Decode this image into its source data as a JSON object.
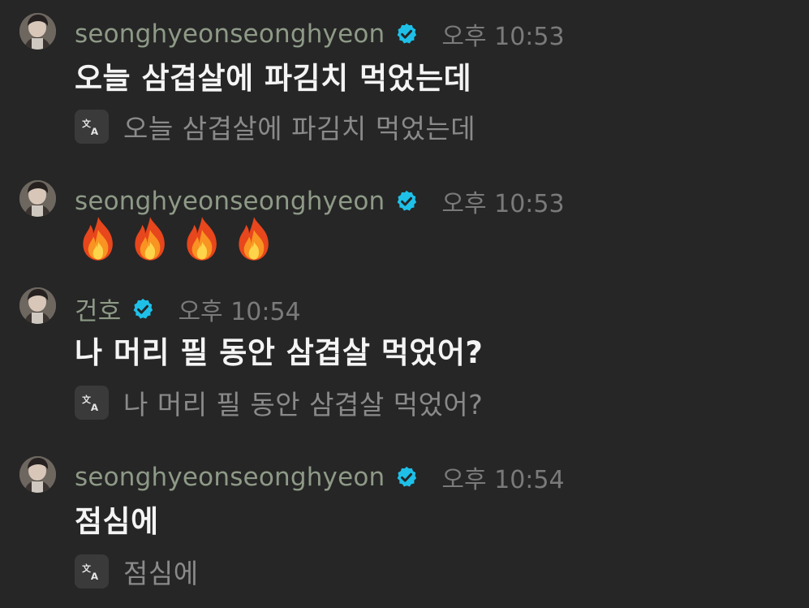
{
  "colors": {
    "background": "#262626",
    "username": "#8e9a87",
    "verified_badge": "#1ec0e8",
    "timestamp": "#7a7a7a",
    "translation_text": "#8a8a8a"
  },
  "messages": [
    {
      "username": "seonghyeonseonghyeon",
      "verified": true,
      "time": "오후 10:53",
      "text": "오늘 삼겹살에 파김치 먹었는데",
      "translation": "오늘 삼겹살에 파김치 먹었는데",
      "avatar_icon": "user-avatar"
    },
    {
      "username": "seonghyeonseonghyeon",
      "verified": true,
      "time": "오후 10:53",
      "emojis": [
        "fire-emoji",
        "fire-emoji",
        "fire-emoji",
        "fire-emoji"
      ],
      "avatar_icon": "user-avatar"
    },
    {
      "username": "건호",
      "verified": true,
      "time": "오후 10:54",
      "text": "나 머리 필 동안 삼겹살 먹었어?",
      "translation": "나 머리 필 동안 삼겹살 먹었어?",
      "avatar_icon": "user-avatar"
    },
    {
      "username": "seonghyeonseonghyeon",
      "verified": true,
      "time": "오후 10:54",
      "text": "점심에",
      "translation": "점심에",
      "avatar_icon": "user-avatar"
    }
  ],
  "icons": {
    "verified": "verified-badge-icon",
    "translate": "translate-icon"
  }
}
